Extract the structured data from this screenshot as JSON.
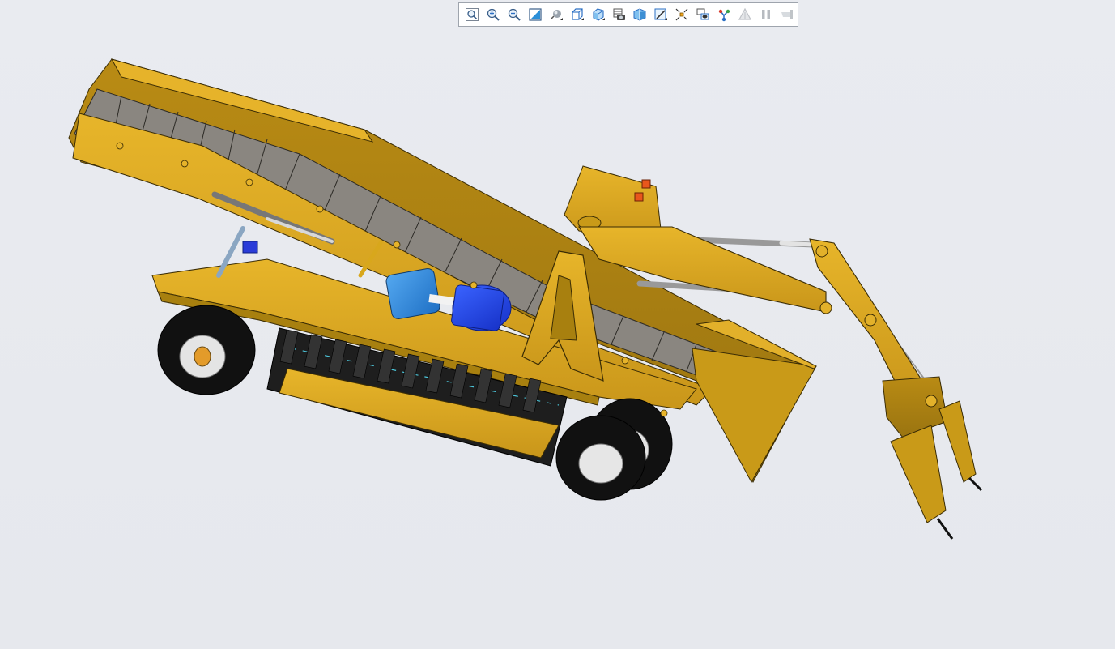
{
  "viewer": {
    "background": "#e8eaef",
    "model_color": "#d8a71c",
    "accent_blue": "#1f4ff0",
    "light_blue": "#2f8fe0"
  },
  "toolbar": {
    "items": [
      {
        "icon": "zoom-fit-icon",
        "enabled": true
      },
      {
        "icon": "zoom-in-icon",
        "enabled": true
      },
      {
        "icon": "zoom-out-icon",
        "enabled": true
      },
      {
        "icon": "zoom-window-icon",
        "enabled": true
      },
      {
        "icon": "display-style-icon",
        "enabled": true
      },
      {
        "icon": "view-orientation-icon",
        "enabled": true
      },
      {
        "icon": "standard-views-icon",
        "enabled": true
      },
      {
        "icon": "camera-icon",
        "enabled": true
      },
      {
        "icon": "section-view-icon",
        "enabled": true
      },
      {
        "icon": "markup-icon",
        "enabled": true
      },
      {
        "icon": "explode-icon",
        "enabled": true
      },
      {
        "icon": "show-hide-icon",
        "enabled": true
      },
      {
        "icon": "structure-icon",
        "enabled": true
      },
      {
        "icon": "measure-icon",
        "enabled": false
      },
      {
        "icon": "pause-icon",
        "enabled": false
      },
      {
        "icon": "end-icon",
        "enabled": false
      }
    ]
  }
}
